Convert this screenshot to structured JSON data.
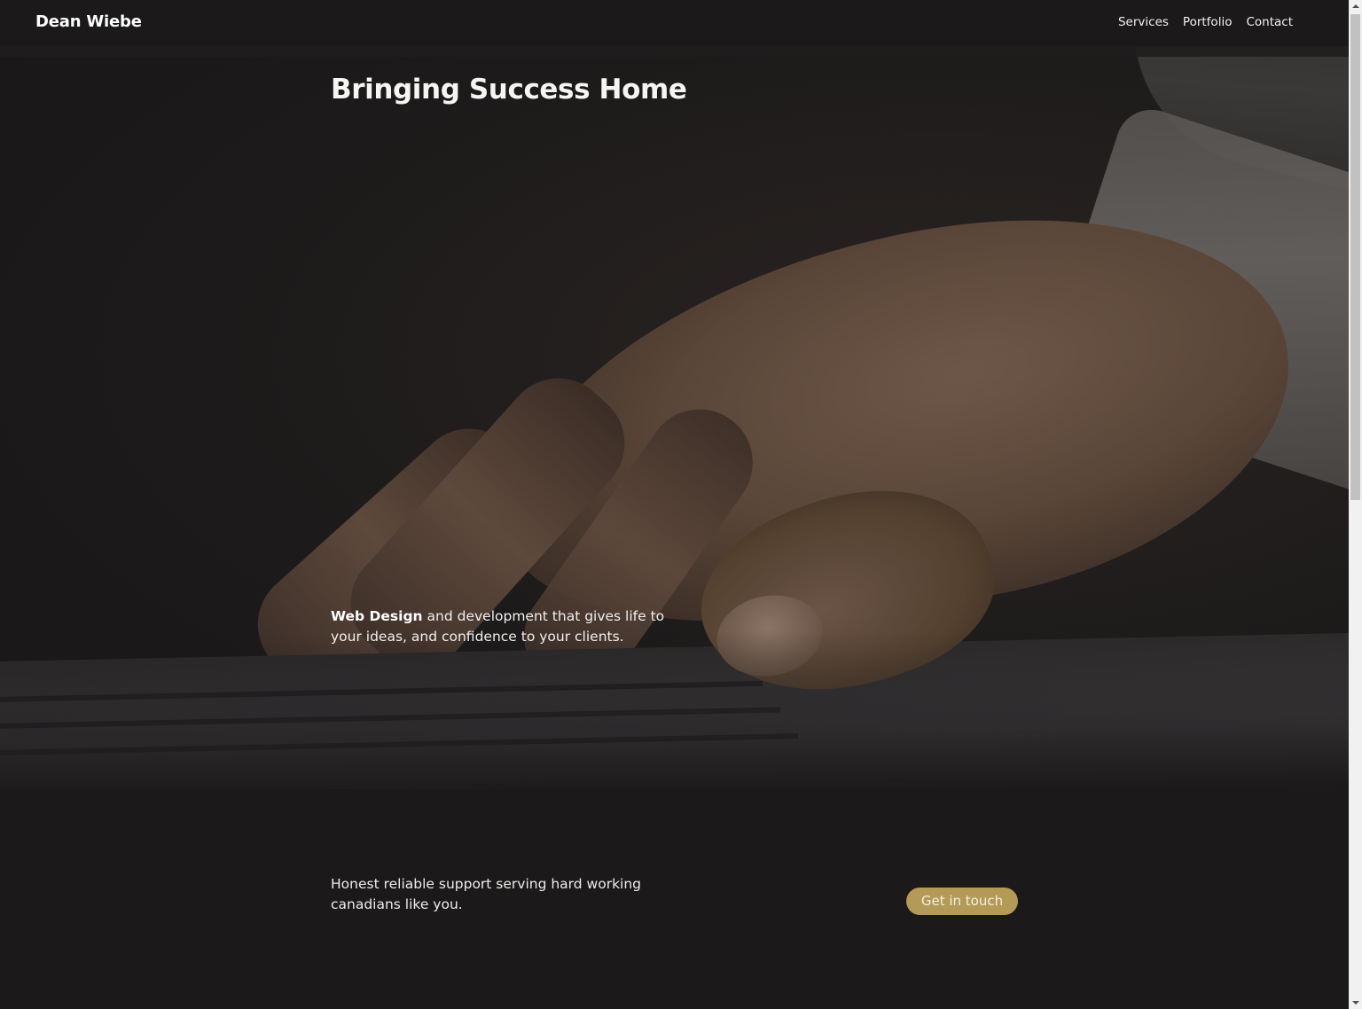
{
  "header": {
    "brand": "Dean Wiebe",
    "nav": [
      {
        "label": "Services"
      },
      {
        "label": "Portfolio"
      },
      {
        "label": "Contact"
      }
    ]
  },
  "hero": {
    "title": "Bringing Success Home",
    "tagline_bold": "Web Design",
    "tagline_rest": " and development that gives life to your ideas, and confidence to your clients."
  },
  "cta": {
    "text": "Honest reliable support serving hard working canadians like you.",
    "button_label": "Get in touch",
    "button_color": "#b39a56"
  },
  "colors": {
    "background": "#1b191a",
    "accent": "#b39a56"
  }
}
